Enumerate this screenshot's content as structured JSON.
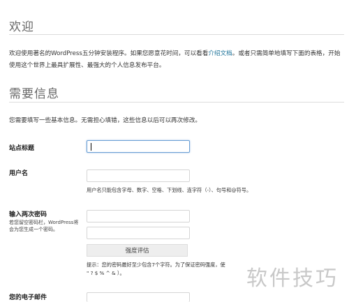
{
  "welcome": {
    "title": "欢迎",
    "intro_before": "欢迎使用著名的WordPress五分钟安装程序。如果您愿意花时间，可以看看",
    "intro_link": "介绍文档",
    "intro_after": "。或者只需简单地填写下面的表格，开始使用这个世界上最具扩展性、最强大的个人信息发布平台。"
  },
  "required": {
    "title": "需要信息",
    "description": "您需要填写一些基本信息。无需担心填错，这些信息以后可以再次修改。"
  },
  "form": {
    "site_title_label": "站点标题",
    "site_title_value": "",
    "username_label": "用户名",
    "username_value": "",
    "username_hint": "用户名只能包含字母、数字、空格、下划线、连字符（-）、句号和@符号。",
    "password_label": "输入两次密码",
    "password_left_hint": "若您留空密码栏，WordPress将会为您生成一个密码。",
    "password1_value": "",
    "password2_value": "",
    "strength_label": "强度评估",
    "password_hint_line1": "提示：您的密码最好至少包含7个字符。为了保证密码强度，使",
    "password_hint_line2": "\" ? $ % ^ & ）。",
    "email_label": "您的电子邮件",
    "email_value": ""
  },
  "watermark": "软件技巧"
}
